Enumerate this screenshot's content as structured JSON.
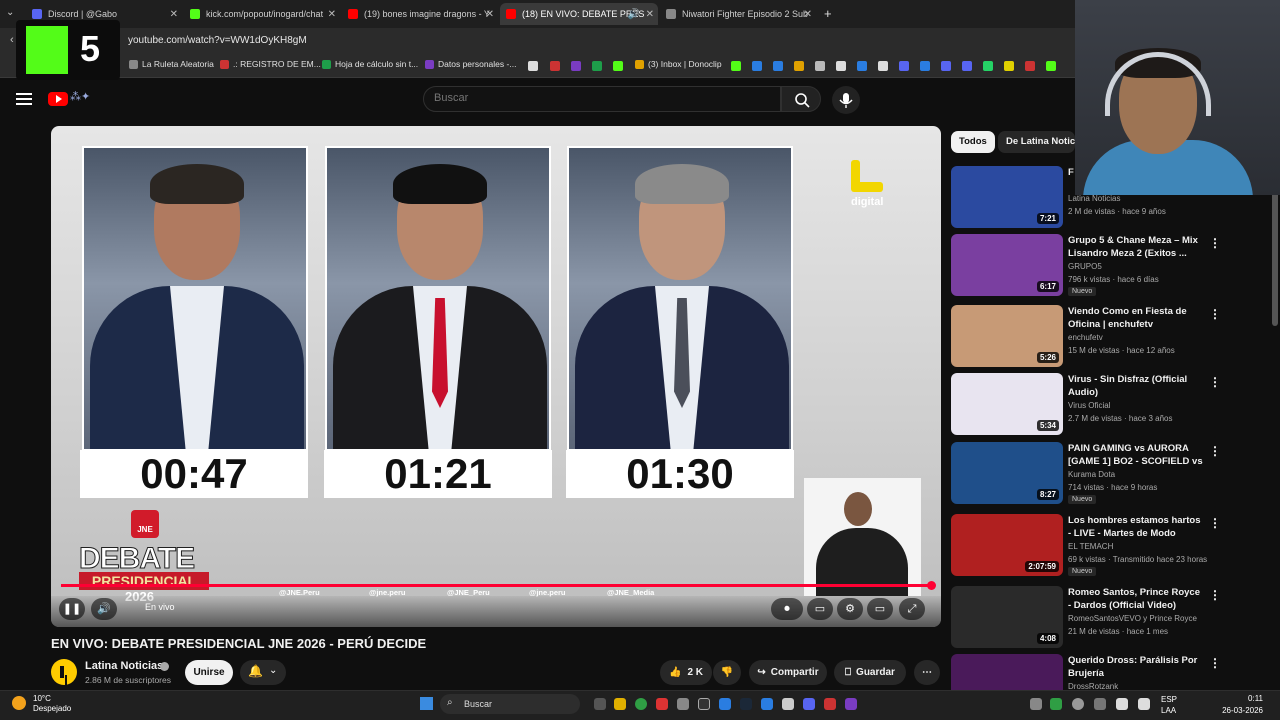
{
  "browser": {
    "tabs": [
      {
        "title": "Discord | @Gabo",
        "color": "#5865f2",
        "active": false
      },
      {
        "title": "kick.com/popout/inogard/chat",
        "color": "#53fc18",
        "active": false
      },
      {
        "title": "(19) bones imagine dragons - Y",
        "color": "#ff0000",
        "active": false
      },
      {
        "title": "(18) EN VIVO: DEBATE PRES",
        "color": "#ff0000",
        "active": true
      },
      {
        "title": "Niwatori Fighter Episodio 2 Sub",
        "color": "#888888",
        "active": false
      }
    ],
    "new_tab": "+",
    "url": "youtube.com/watch?v=WW1dOyKH8gM",
    "bookmarks": [
      {
        "label": "La Ruleta Aleatoria",
        "color": "#888"
      },
      {
        "label": ".: REGISTRO DE EM...",
        "color": "#c33"
      },
      {
        "label": "Hoja de cálculo sin t...",
        "color": "#1e9e4a"
      },
      {
        "label": "Datos personales -...",
        "color": "#7a3cc2"
      },
      {
        "label": "(3) Inbox | Donoclip",
        "color": "#e0a100"
      }
    ]
  },
  "overlay": {
    "kick_number": "5"
  },
  "youtube": {
    "search_placeholder": "Buscar",
    "video": {
      "timers": [
        "00:47",
        "01:21",
        "01:30"
      ],
      "brand_label": "digital",
      "debate_title": "DEBATE",
      "debate_sub": "PRESIDENCIAL",
      "debate_year": "2026",
      "jne_badge": "JNE",
      "socials": [
        "@JNE.Peru",
        "@jne.peru",
        "@JNE_Peru",
        "@jne.peru",
        "@JNE_Media"
      ],
      "live_label": "En vivo",
      "progress": 1.0
    },
    "title": "EN VIVO: DEBATE PRESIDENCIAL JNE 2026 - PERÚ DECIDE",
    "channel": {
      "name": "Latina Noticias",
      "subscribers": "2.86 M de suscriptores"
    },
    "actions": {
      "join": "Unirse",
      "likes": "2 K",
      "share": "Compartir",
      "save": "Guardar"
    },
    "chips": [
      "Todos",
      "De Latina Noticias"
    ],
    "recommendations": [
      {
        "title": "F G",
        "channel": "Latina Noticias",
        "meta": "2 M de vistas · hace 9 años",
        "duration": "7:21",
        "badge": "",
        "thumb": "#2b4aa0"
      },
      {
        "title": "Grupo 5 & Chane Meza – Mix Lisandro Meza 2 (Exitos ...",
        "channel": "GRUPO5",
        "meta": "796 k vistas · hace 6 días",
        "duration": "6:17",
        "badge": "Nuevo",
        "thumb": "#7a3fa0"
      },
      {
        "title": "Viendo Como en Fiesta de Oficina | enchufetv",
        "channel": "enchufetv",
        "meta": "15 M de vistas · hace 12 años",
        "duration": "5:26",
        "badge": "",
        "thumb": "#c79a76"
      },
      {
        "title": "Virus - Sin Disfraz (Official Audio)",
        "channel": "Virus Oficial",
        "meta": "2.7 M de vistas · hace 3 años",
        "duration": "5:34",
        "badge": "",
        "thumb": "#e8e4f0"
      },
      {
        "title": "PAIN GAMING vs AURORA [GAME 1] BO2 - SCOFIELD vs ...",
        "channel": "Kurama Dota",
        "meta": "714 vistas · hace 9 horas",
        "duration": "8:27",
        "badge": "Nuevo",
        "thumb": "#1f4f8a"
      },
      {
        "title": "Los hombres estamos hartos - LIVE - Martes de Modo Guerra",
        "channel": "EL TEMACH",
        "meta": "69 k vistas · Transmitido hace 23 horas",
        "duration": "2:07:59",
        "badge": "Nuevo",
        "thumb": "#b02020"
      },
      {
        "title": "Romeo Santos, Prince Royce - Dardos (Official Video)",
        "channel": "RomeoSantosVEVO y Prince Royce",
        "meta": "21 M de vistas · hace 1 mes",
        "duration": "4:08",
        "badge": "",
        "thumb": "#2a2a2a"
      },
      {
        "title": "Querido Dross: Parálisis Por Brujería",
        "channel": "DrossRotzank",
        "meta": "",
        "duration": "",
        "badge": "",
        "thumb": "#4a1a5a"
      }
    ]
  },
  "taskbar": {
    "temperature": "10°C",
    "weather": "Despejado",
    "search": "Buscar",
    "lang_1": "ESP",
    "lang_2": "LAA",
    "time": "0:11",
    "date": "26-03-2026"
  },
  "colors": {
    "accent": "#ff0033",
    "kick": "#53fc18",
    "latina_yellow": "#f2d600"
  }
}
